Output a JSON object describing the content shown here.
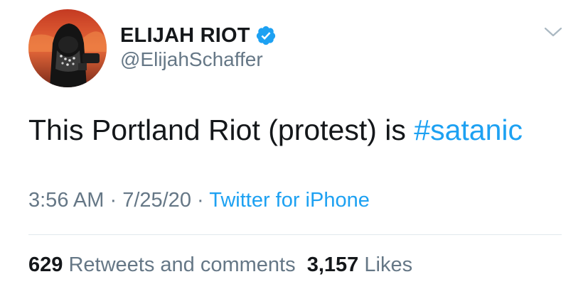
{
  "tweet": {
    "author": {
      "display_name": "ELIJAH RIOT",
      "handle": "@ElijahSchaffer",
      "verified": true
    },
    "text": "This Portland Riot (protest) is ",
    "hashtag": "#satanic",
    "time": "3:56 AM",
    "separator": " · ",
    "date": "7/25/20",
    "source": "Twitter for iPhone",
    "retweets_count": "629",
    "retweets_label": "Retweets and comments",
    "likes_count": "3,157",
    "likes_label": "Likes"
  },
  "colors": {
    "text": "#14171a",
    "secondary": "#657786",
    "link": "#1da1f2",
    "divider": "#e1e8ed"
  },
  "icons": {
    "verified": "verified-badge-icon",
    "menu": "chevron-down-icon"
  }
}
